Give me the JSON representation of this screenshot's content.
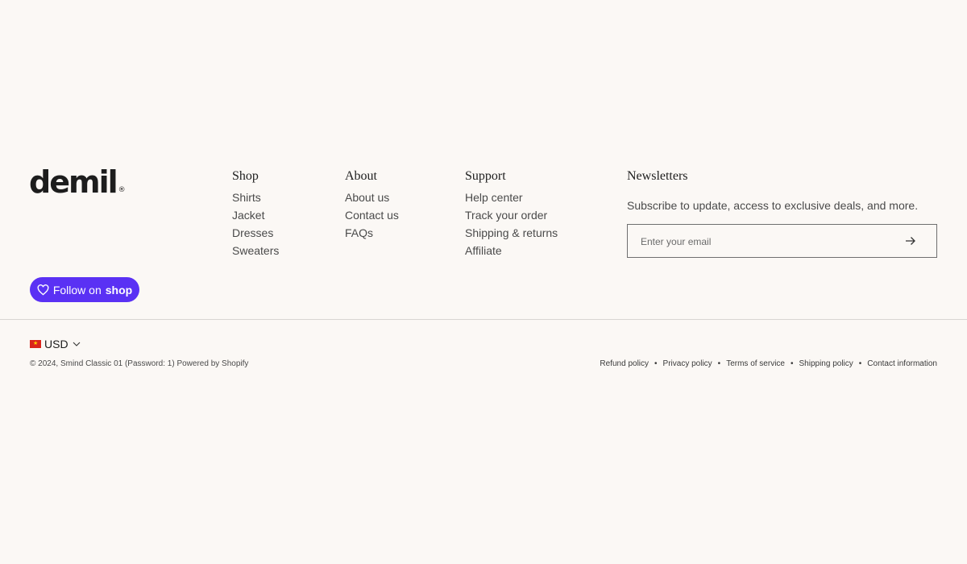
{
  "brand": {
    "logo_text": "demil",
    "logo_mark": "®"
  },
  "columns": [
    {
      "heading": "Shop",
      "items": [
        "Shirts",
        "Jacket",
        "Dresses",
        "Sweaters"
      ]
    },
    {
      "heading": "About",
      "items": [
        "About us",
        "Contact us",
        "FAQs"
      ]
    },
    {
      "heading": "Support",
      "items": [
        "Help center",
        "Track your order",
        "Shipping & returns",
        "Affiliate"
      ]
    }
  ],
  "newsletter": {
    "heading": "Newsletters",
    "description": "Subscribe to update, access to exclusive deals, and more.",
    "email_placeholder": "Enter your email",
    "submit_icon": "arrow-right-icon"
  },
  "follow_button": {
    "label": "Follow on",
    "brand": "shop",
    "icon": "heart-icon",
    "color": "#5a31f4"
  },
  "currency": {
    "code": "USD",
    "flag": "vietnam-flag"
  },
  "copyright": "© 2024, Smind Classic 01 (Password: 1) Powered by Shopify",
  "policies": [
    "Refund policy",
    "Privacy policy",
    "Terms of service",
    "Shipping policy",
    "Contact information"
  ],
  "colors": {
    "background": "#fbf8f5",
    "accent": "#5a31f4"
  }
}
